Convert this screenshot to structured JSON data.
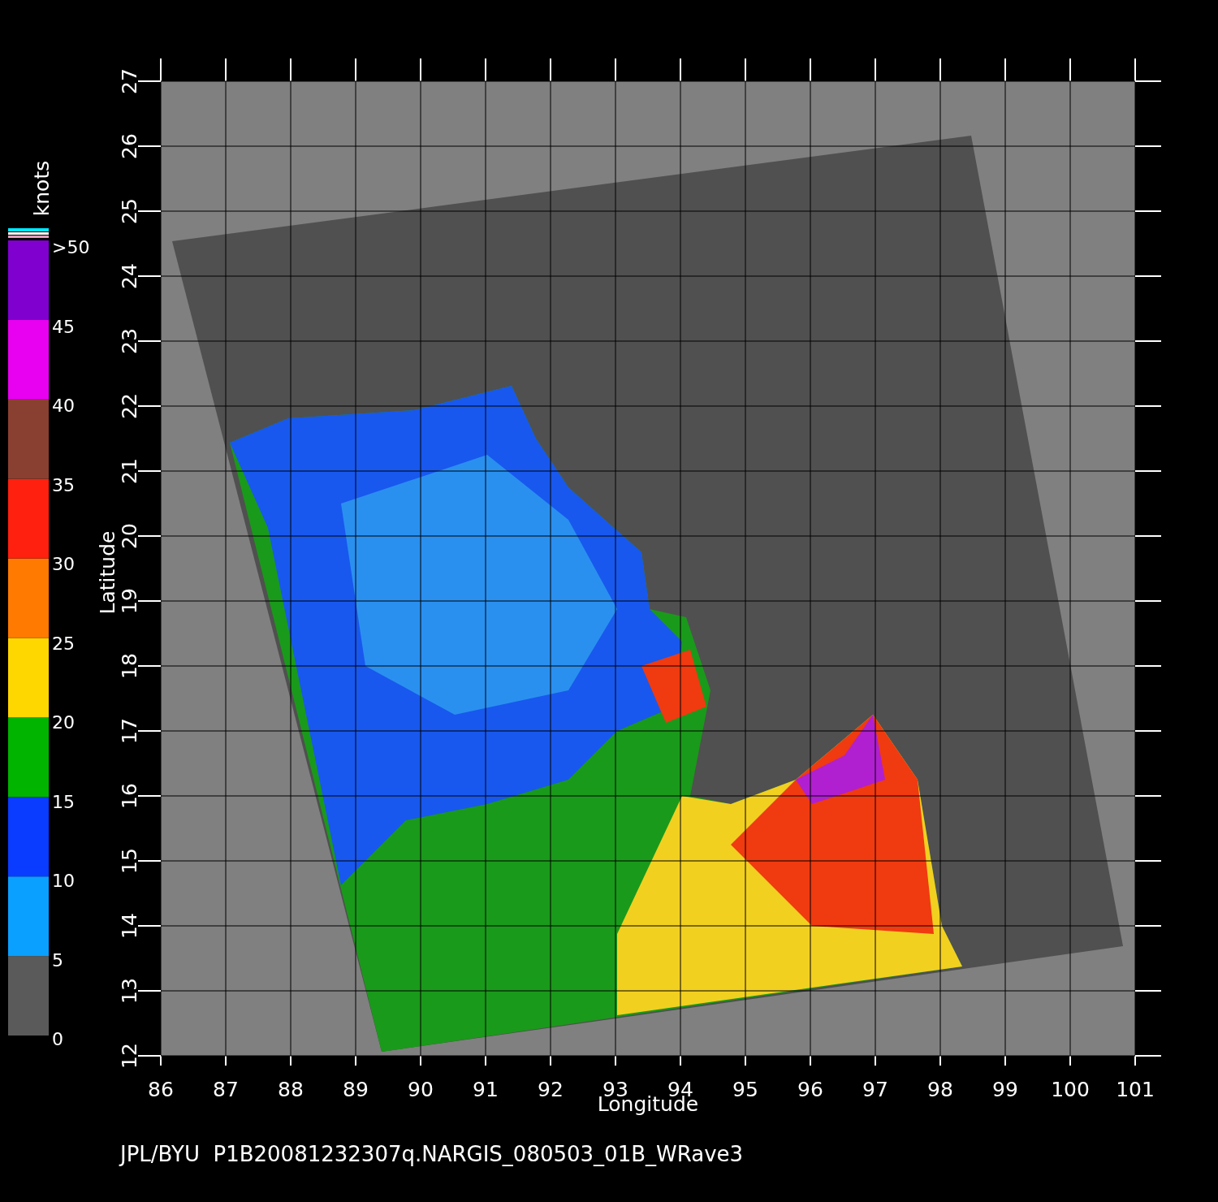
{
  "plot": {
    "x_axis": {
      "label": "Longitude",
      "ticks": [
        "86",
        "87",
        "88",
        "89",
        "90",
        "91",
        "92",
        "93",
        "94",
        "95",
        "96",
        "97",
        "98",
        "99",
        "100",
        "101"
      ]
    },
    "y_axis": {
      "label": "Latitude",
      "ticks": [
        "12",
        "13",
        "14",
        "15",
        "16",
        "17",
        "18",
        "19",
        "20",
        "21",
        "22",
        "23",
        "24",
        "25",
        "26",
        "27"
      ]
    }
  },
  "colorbar": {
    "unit": "knots",
    "labels": [
      ">50",
      "45",
      "40",
      "35",
      "30",
      "25",
      "20",
      "15",
      "10",
      "5",
      "0"
    ],
    "segments": [
      {
        "color": "#5a5a5a"
      },
      {
        "color": "#0aa0ff"
      },
      {
        "color": "#0a3cff"
      },
      {
        "color": "#00b400"
      },
      {
        "color": "#ffd700"
      },
      {
        "color": "#ff7a00"
      },
      {
        "color": "#ff2010"
      },
      {
        "color": "#8a4030"
      },
      {
        "color": "#e800f0"
      },
      {
        "color": "#8000d0"
      }
    ]
  },
  "footer": "JPL/BYU  P1B20081232307q.NARGIS_080503_01B_WRave3"
}
